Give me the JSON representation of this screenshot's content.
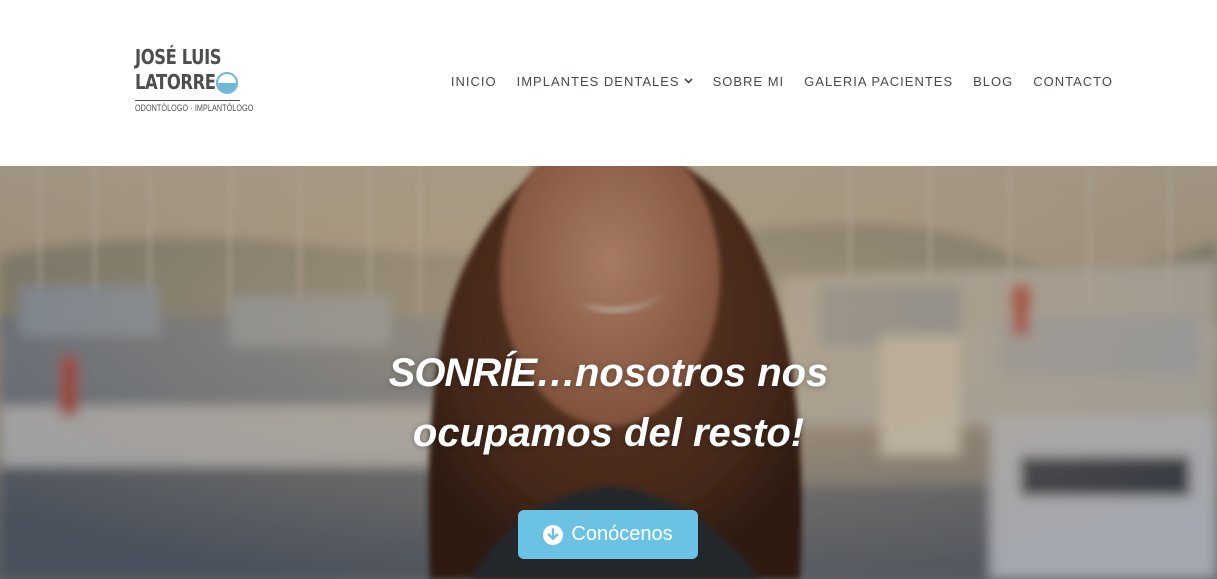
{
  "logo": {
    "line1": "JOSÉ LUIS",
    "line2": "LATORRE",
    "tagline": "ODONTÓLOGO · IMPLANTÓLOGO",
    "accent_color": "#6fb7d6"
  },
  "nav": {
    "items": [
      {
        "label": "INICIO"
      },
      {
        "label": "IMPLANTES DENTALES",
        "icon": "chevron-down-icon"
      },
      {
        "label": "SOBRE MI"
      },
      {
        "label": "GALERIA PACIENTES"
      },
      {
        "label": "BLOG"
      },
      {
        "label": "CONTACTO"
      }
    ]
  },
  "hero": {
    "heading_strong": "SONRÍE…",
    "heading_rest_line1": "nosotros nos",
    "heading_line2": "ocupamos del resto!",
    "cta_label": "Conócenos",
    "cta_icon": "arrow-down-circle-icon",
    "cta_color": "#6cc2e3"
  }
}
